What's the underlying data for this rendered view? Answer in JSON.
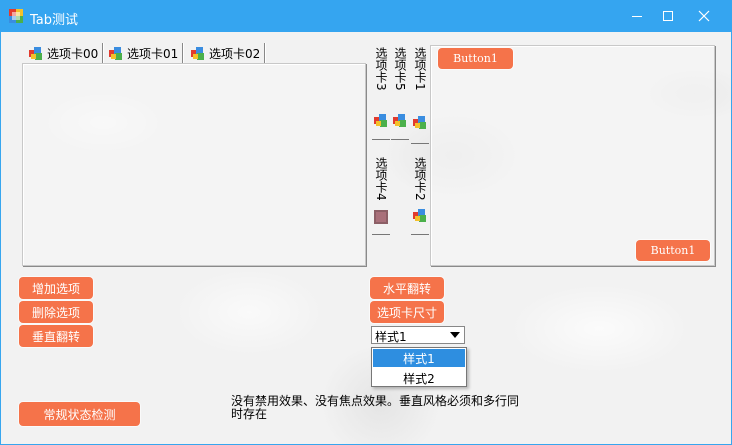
{
  "window": {
    "title": "Tab测试",
    "icon": "app-icon",
    "controls": [
      "minimize-icon",
      "maximize-icon",
      "close-icon"
    ]
  },
  "colors": {
    "titlebar": "#35a5f0",
    "button": "#f5734a",
    "dropdown_selected": "#2e8ee0"
  },
  "tabs_top": {
    "items": [
      {
        "label": "选项卡00",
        "icon": "tab-icon"
      },
      {
        "label": "选项卡01",
        "icon": "tab-icon"
      },
      {
        "label": "选项卡02",
        "icon": "tab-icon"
      }
    ]
  },
  "tabs_vertical": {
    "items": [
      {
        "label": "选项卡3",
        "icon": "tab-icon"
      },
      {
        "label": "选项卡5",
        "icon": "tab-icon"
      },
      {
        "label": "选项卡1",
        "icon": "tab-icon"
      },
      {
        "label": "选项卡4",
        "icon": "image-icon"
      },
      {
        "label": "选项卡2",
        "icon": "tab-icon"
      }
    ],
    "button_top": "Button1",
    "button_bottom": "Button1"
  },
  "buttons": {
    "add_tab": "增加选项",
    "delete_tab": "删除选项",
    "flip_vertical": "垂直翻转",
    "flip_horizontal": "水平翻转",
    "tab_size": "选项卡尺寸",
    "state_check": "常规状态检测"
  },
  "style_select": {
    "value": "样式1",
    "options": [
      "样式1",
      "样式2"
    ],
    "selected_index": 0
  },
  "note": "没有禁用效果、没有焦点效果。垂直风格必须和多行同时存在"
}
